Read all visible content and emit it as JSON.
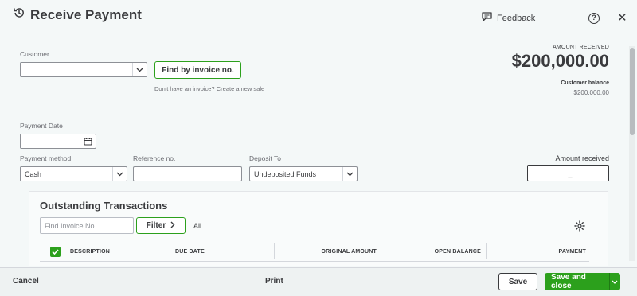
{
  "header": {
    "title": "Receive Payment",
    "feedback_label": "Feedback",
    "help_glyph": "?",
    "close_glyph": "✕"
  },
  "customer": {
    "label": "Customer",
    "value": "",
    "find_invoice_label": "Find by invoice no.",
    "hint": "Don't have an invoice? Create a new sale"
  },
  "amount_summary": {
    "label": "AMOUNT RECEIVED",
    "value": "$200,000.00",
    "balance_label": "Customer balance",
    "balance_value": "$200,000.00"
  },
  "payment_date": {
    "label": "Payment Date",
    "value": ""
  },
  "payment_method": {
    "label": "Payment method",
    "value": "Cash"
  },
  "reference": {
    "label": "Reference no.",
    "value": ""
  },
  "deposit_to": {
    "label": "Deposit To",
    "value": "Undeposited Funds"
  },
  "amount_received": {
    "label": "Amount received",
    "value": "_"
  },
  "outstanding": {
    "title": "Outstanding Transactions",
    "search_placeholder": "Find Invoice No.",
    "filter_label": "Filter",
    "all_label": "All",
    "columns": [
      "DESCRIPTION",
      "DUE DATE",
      "ORIGINAL AMOUNT",
      "OPEN BALANCE",
      "PAYMENT"
    ]
  },
  "footer": {
    "cancel_label": "Cancel",
    "print_label": "Print",
    "save_label": "Save",
    "save_close_label": "Save and close"
  },
  "colors": {
    "accent_green": "#2ca01c",
    "text": "#393a3d",
    "background": "#f4f8f8"
  }
}
